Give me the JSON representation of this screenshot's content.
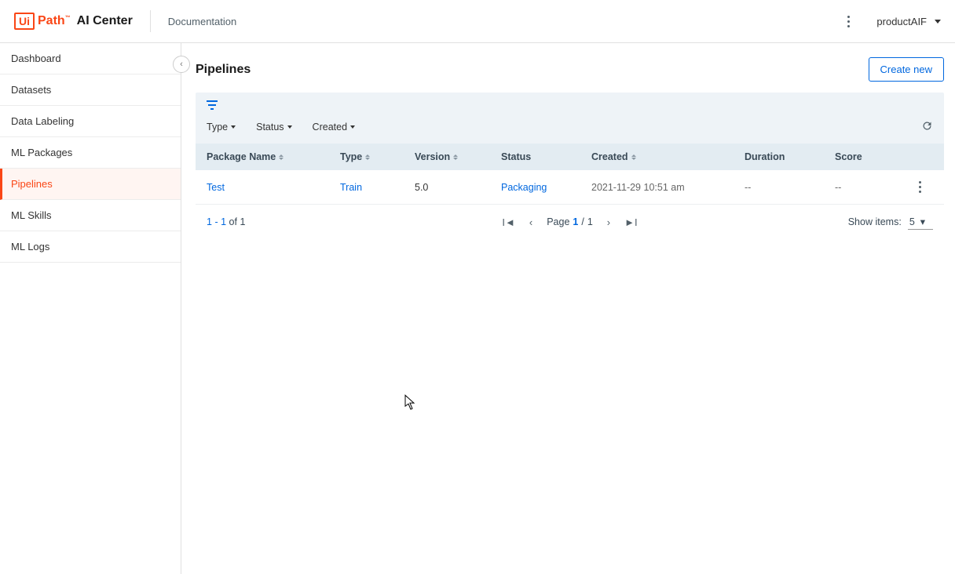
{
  "header": {
    "logo_box": "Ui",
    "logo_text": "Path",
    "logo_tm": "™",
    "app_name": "AI Center",
    "doc_link": "Documentation",
    "user": "productAIF"
  },
  "sidebar": {
    "items": [
      {
        "label": "Dashboard",
        "active": false
      },
      {
        "label": "Datasets",
        "active": false
      },
      {
        "label": "Data Labeling",
        "active": false
      },
      {
        "label": "ML Packages",
        "active": false
      },
      {
        "label": "Pipelines",
        "active": true
      },
      {
        "label": "ML Skills",
        "active": false
      },
      {
        "label": "ML Logs",
        "active": false
      }
    ]
  },
  "main": {
    "title": "Pipelines",
    "create_btn": "Create new",
    "filters": [
      {
        "label": "Type"
      },
      {
        "label": "Status"
      },
      {
        "label": "Created"
      }
    ],
    "columns": {
      "pkg": "Package Name",
      "type": "Type",
      "version": "Version",
      "status": "Status",
      "created": "Created",
      "duration": "Duration",
      "score": "Score"
    },
    "rows": [
      {
        "pkg": "Test",
        "type": "Train",
        "version": "5.0",
        "status": "Packaging",
        "created": "2021-11-29 10:51 am",
        "duration": "--",
        "score": "--"
      }
    ],
    "pager": {
      "range_from": "1",
      "range_to": "1",
      "of_word": "of",
      "total": "1",
      "page_word": "Page",
      "page_cur": "1",
      "page_sep": "/",
      "page_total": "1",
      "show_label": "Show items:",
      "show_value": "5"
    }
  }
}
